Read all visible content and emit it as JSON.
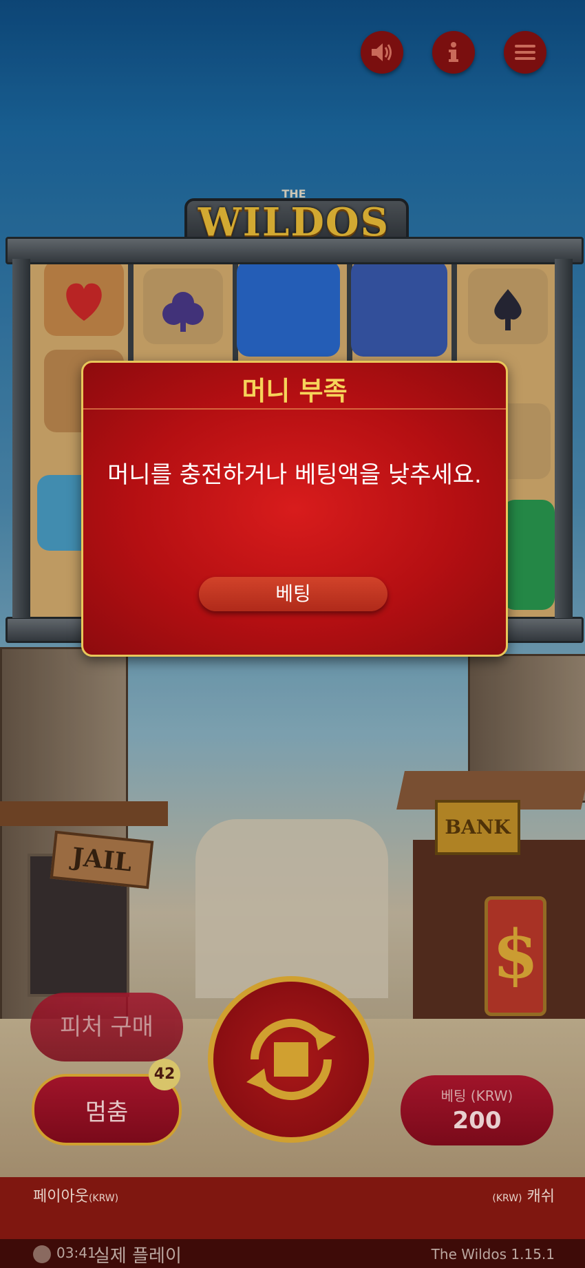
{
  "header": {
    "sound_icon": "speaker-icon",
    "info_icon": "info-icon",
    "menu_icon": "hamburger-menu-icon"
  },
  "game": {
    "logo_the": "THE",
    "logo": "WILDOS"
  },
  "town": {
    "jail_sign": "JAIL",
    "bank_sign": "BANK",
    "dollar_sign": "$"
  },
  "modal": {
    "title": "머니 부족",
    "message": "머니를 충전하거나 베팅액을 낮추세요.",
    "button_label": "베팅"
  },
  "controls": {
    "feature_buy_label": "피처 구매",
    "stop_label": "멈춤",
    "autoplay_count": "42",
    "spin_icon": "spin-stop-icon",
    "bet_label": "베팅 (KRW)",
    "bet_value": "200"
  },
  "footer": {
    "payout_label": "페이아웃",
    "payout_unit": "(KRW)",
    "cash_unit": "(KRW)",
    "cash_label": "캐쉬",
    "time": "03:41",
    "mode": "실제 플레이",
    "version": "The Wildos 1.15.1"
  },
  "colors": {
    "modal_bg": "#b40f12",
    "modal_title": "#f6d35a",
    "modal_border": "#e8c75a",
    "button_bg": "#c0321f",
    "gold_accent": "#d0a030",
    "footer_bg": "#7f1710"
  }
}
